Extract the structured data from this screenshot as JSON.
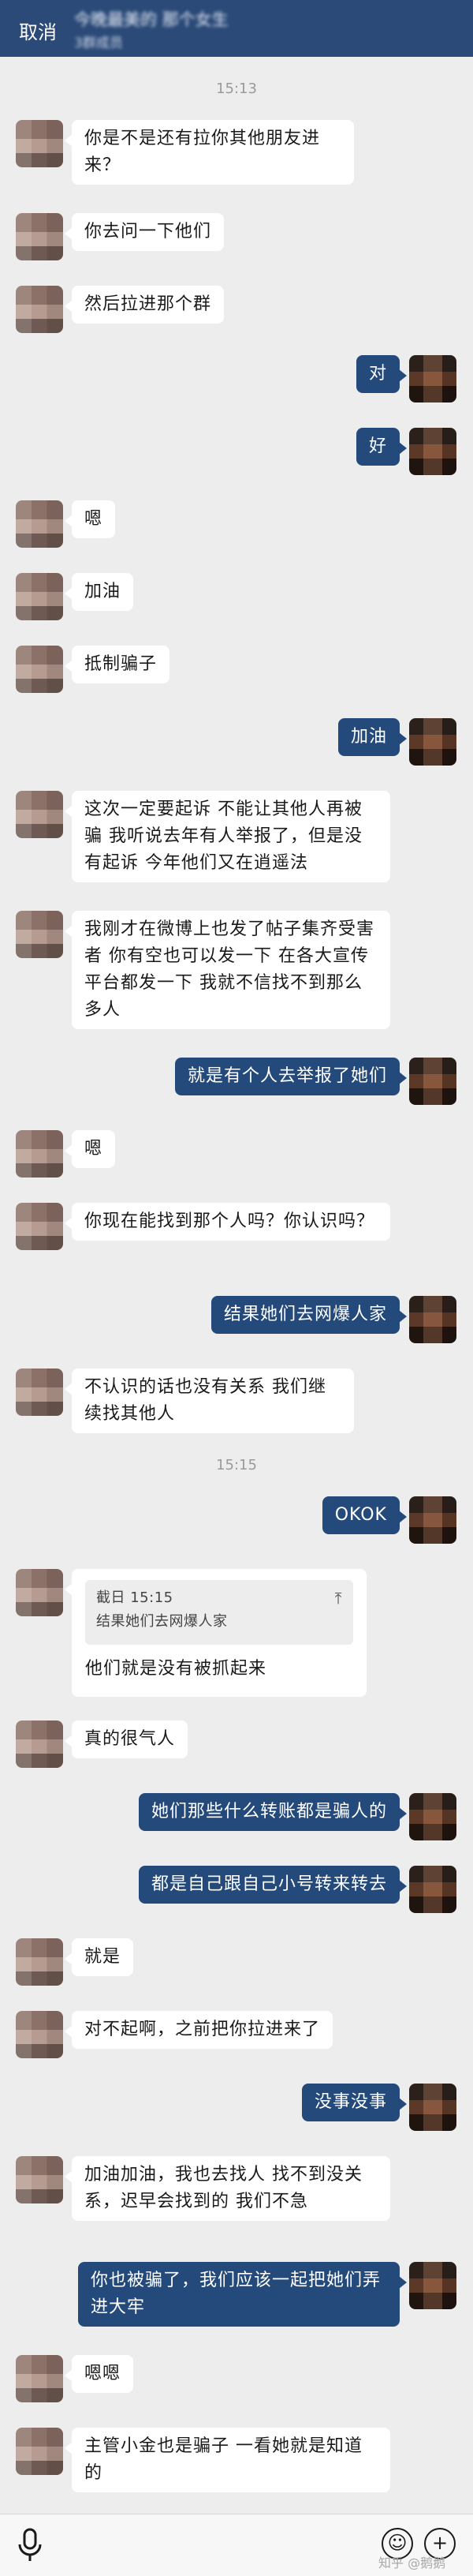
{
  "header": {
    "cancel_label": "取消",
    "title": "今晚最美的 那个女生",
    "subtitle": "3群成员"
  },
  "icons": {
    "mic": "microphone-icon",
    "emoji": "emoji-icon",
    "plus": "plus-icon",
    "quote_up": "arrow-up-icon"
  },
  "colors": {
    "header_bg": "#2b4a78",
    "sent_bubble": "#244a7c",
    "received_bubble": "#ffffff",
    "chat_bg": "#ededed"
  },
  "timestamps": [
    "15:13",
    "15:15"
  ],
  "messages": [
    {
      "side": "left",
      "text": "你是不是还有拉你其他朋友进来？"
    },
    {
      "side": "left",
      "text": "你去问一下他们"
    },
    {
      "side": "left",
      "text": "然后拉进那个群"
    },
    {
      "side": "right",
      "text": "对"
    },
    {
      "side": "right",
      "text": "好"
    },
    {
      "side": "left",
      "text": "嗯"
    },
    {
      "side": "left",
      "text": "加油"
    },
    {
      "side": "left",
      "text": "抵制骗子"
    },
    {
      "side": "right",
      "text": "加油"
    },
    {
      "side": "left",
      "text": "这次一定要起诉 不能让其他人再被骗 我听说去年有人举报了，但是没有起诉 今年他们又在逍遥法"
    },
    {
      "side": "left",
      "text": "我刚才在微博上也发了帖子集齐受害者 你有空也可以发一下 在各大宣传平台都发一下 我就不信找不到那么多人"
    },
    {
      "side": "right",
      "text": "就是有个人去举报了她们"
    },
    {
      "side": "left",
      "text": "嗯"
    },
    {
      "side": "left",
      "text": "你现在能找到那个人吗？你认识吗？"
    },
    {
      "side": "right",
      "text": "结果她们去网爆人家"
    },
    {
      "side": "left",
      "text": "不认识的话也没有关系 我们继续找其他人"
    },
    {
      "side": "right",
      "text": "OKOK"
    },
    {
      "side": "left",
      "text": "他们就是没有被抓起来",
      "quote": {
        "meta": "截日 15:15",
        "text": "结果她们去网爆人家"
      }
    },
    {
      "side": "left",
      "text": "真的很气人"
    },
    {
      "side": "right",
      "text": "她们那些什么转账都是骗人的"
    },
    {
      "side": "right",
      "text": "都是自己跟自己小号转来转去"
    },
    {
      "side": "left",
      "text": "就是"
    },
    {
      "side": "left",
      "text": "对不起啊，之前把你拉进来了"
    },
    {
      "side": "right",
      "text": "没事没事"
    },
    {
      "side": "left",
      "text": "加油加油，我也去找人 找不到没关系，迟早会找到的 我们不急"
    },
    {
      "side": "right",
      "text": "你也被骗了，我们应该一起把她们弄进大牢"
    },
    {
      "side": "left",
      "text": "嗯嗯"
    },
    {
      "side": "left",
      "text": "主管小金也是骗子 一看她就是知道的"
    }
  ],
  "watermark": "知乎 @鹅鹅"
}
